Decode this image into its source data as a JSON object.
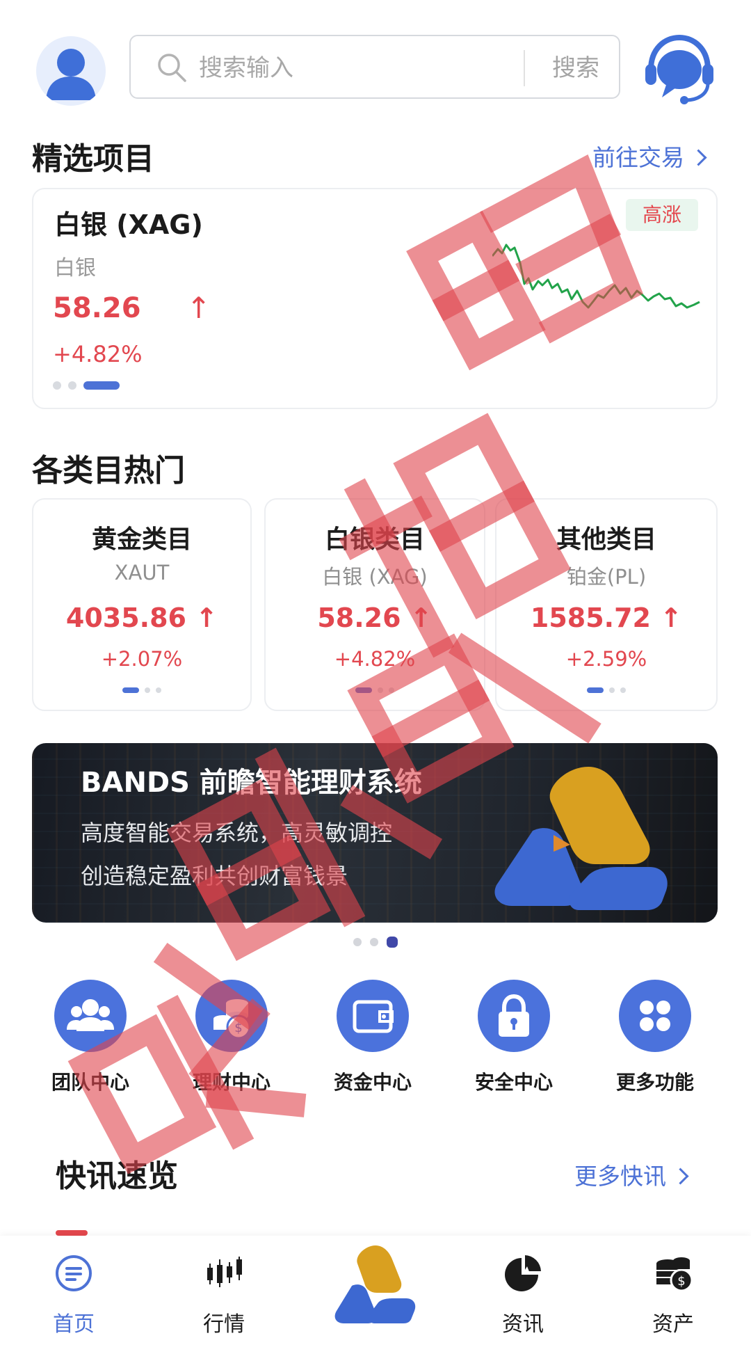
{
  "header": {
    "search_placeholder": "搜索输入",
    "search_button": "搜索"
  },
  "featured": {
    "title": "精选项目",
    "link": "前往交易",
    "item": {
      "name": "白银 (XAG)",
      "sub": "白银",
      "price": "58.26",
      "arrow": "↑",
      "change": "+4.82%",
      "badge": "高涨"
    }
  },
  "categories": {
    "title": "各类目热门",
    "items": [
      {
        "name": "黄金类目",
        "symbol": "XAUT",
        "price": "4035.86 ↑",
        "change": "+2.07%"
      },
      {
        "name": "白银类目",
        "symbol": "白银 (XAG)",
        "price": "58.26 ↑",
        "change": "+4.82%"
      },
      {
        "name": "其他类目",
        "symbol": "铂金(PL)",
        "price": "1585.72 ↑",
        "change": "+2.59%"
      }
    ]
  },
  "banner": {
    "title": "BANDS 前瞻智能理财系统",
    "line1": "高度智能交易系统，高灵敏调控",
    "line2": "创造稳定盈利共创财富钱景"
  },
  "features": [
    {
      "label": "团队中心",
      "icon": "team-icon"
    },
    {
      "label": "理财中心",
      "icon": "coins-icon"
    },
    {
      "label": "资金中心",
      "icon": "wallet-icon"
    },
    {
      "label": "安全中心",
      "icon": "lock-icon"
    },
    {
      "label": "更多功能",
      "icon": "grid-dots-icon"
    }
  ],
  "news": {
    "title": "快讯速览",
    "link": "更多快讯"
  },
  "tabbar": {
    "items": [
      {
        "label": "首页",
        "icon": "home-list-icon",
        "active": true
      },
      {
        "label": "行情",
        "icon": "candlestick-icon",
        "active": false
      },
      {
        "label": "资讯",
        "icon": "pie-chart-icon",
        "active": false
      },
      {
        "label": "资产",
        "icon": "coin-stack-icon",
        "active": false
      }
    ]
  },
  "colors": {
    "accent": "#4d72d6",
    "up": "#e2474f",
    "badge_bg": "#e9f6ee",
    "watermark": "#e0454d"
  }
}
